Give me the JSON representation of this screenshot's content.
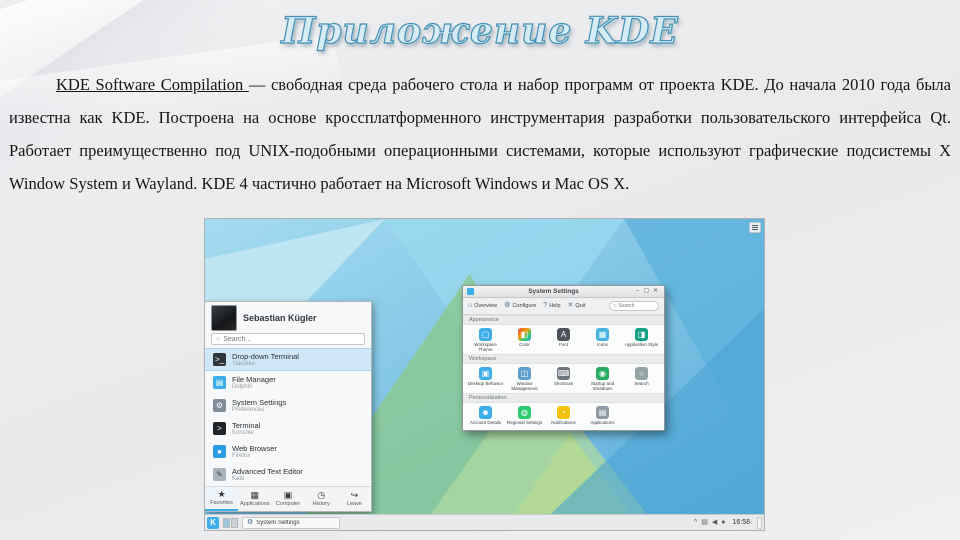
{
  "slide": {
    "title": "Приложение KDE",
    "body_lead": "KDE Software Compilation ",
    "body_rest": "— свободная среда рабочего стола и набор программ от проекта KDE. До начала 2010 года была известна как KDE. Построена на основе кроссплатформенного инструментария разработки пользовательского интерфейса Qt. Работает преимущественно под UNIX-подобными операционными системами, которые используют графические подсистемы X Window System и Wayland. KDE 4 частично работает на Microsoft Windows и Mac OS X.",
    "accent_color": "#4690b5"
  },
  "desktop": {
    "wallpaper": "kde-plasma-next-triangles",
    "launcher": {
      "user_name": "Sebastian Kügler",
      "search_placeholder": "Search...",
      "items": [
        {
          "label": "Drop-down Terminal",
          "sub": "Yakuake",
          "glyph": ">_",
          "style": "background:#31363b"
        },
        {
          "label": "File Manager",
          "sub": "Dolphin",
          "glyph": "▤",
          "style": "background:#3daee9"
        },
        {
          "label": "System Settings",
          "sub": "Preferences",
          "glyph": "⚙",
          "style": "background:#7f8c99"
        },
        {
          "label": "Terminal",
          "sub": "Konsole",
          "glyph": ">",
          "style": "background:#222629"
        },
        {
          "label": "Web Browser",
          "sub": "Firefox",
          "glyph": "●",
          "style": "background:#2d9ce2"
        },
        {
          "label": "Advanced Text Editor",
          "sub": "Kate",
          "glyph": "✎",
          "style": "background:#aab4bc;color:#41464a"
        }
      ],
      "tabs": [
        {
          "label": "Favorites",
          "glyph": "★"
        },
        {
          "label": "Applications",
          "glyph": "▦"
        },
        {
          "label": "Computer",
          "glyph": "▣"
        },
        {
          "label": "History",
          "glyph": "◷"
        },
        {
          "label": "Leave",
          "glyph": "↪"
        }
      ]
    },
    "settings": {
      "title": "System Settings",
      "window_buttons": [
        "–",
        "▢",
        "✕"
      ],
      "toolbar": [
        {
          "label": "Overview",
          "glyph": "⌂"
        },
        {
          "label": "Configure",
          "glyph": "⚙"
        },
        {
          "label": "Help",
          "glyph": "?"
        },
        {
          "label": "Quit",
          "glyph": "✕"
        }
      ],
      "search_placeholder": "Search",
      "sections": [
        {
          "title": "Appearance",
          "items": [
            {
              "label": "Workspace Theme",
              "glyph": "▢",
              "style": "background:#3daee9"
            },
            {
              "label": "Color",
              "glyph": "◧",
              "style": "background:linear-gradient(135deg,#e74c3c,#f39c12 40%,#2ecc71 70%,#3498db)"
            },
            {
              "label": "Font",
              "glyph": "A",
              "style": "background:#4d545b"
            },
            {
              "label": "Icons",
              "glyph": "▦",
              "style": "background:#48b4e0"
            },
            {
              "label": "Application Style",
              "glyph": "◨",
              "style": "background:#16a085"
            }
          ]
        },
        {
          "title": "Workspace",
          "items": [
            {
              "label": "Desktop Behavior",
              "glyph": "▣",
              "style": "background:#3daee9"
            },
            {
              "label": "Window Management",
              "glyph": "◫",
              "style": "background:#5c9fcd"
            },
            {
              "label": "Shortcuts",
              "glyph": "⌨",
              "style": "background:#6e7780"
            },
            {
              "label": "Startup and Shutdown",
              "glyph": "◉",
              "style": "background:#27ae60"
            },
            {
              "label": "Search",
              "glyph": "○",
              "style": "background:#95a5a6"
            }
          ]
        },
        {
          "title": "Personalization",
          "items": [
            {
              "label": "Account Details",
              "glyph": "☻",
              "style": "background:#3daee9"
            },
            {
              "label": "Regional Settings",
              "glyph": "◍",
              "style": "background:#2ecc71"
            },
            {
              "label": "Notifications",
              "glyph": "◔",
              "style": "background:#f1c40f"
            },
            {
              "label": "Applications",
              "glyph": "▤",
              "style": "background:#8e9aa5"
            }
          ]
        }
      ]
    },
    "taskbar": {
      "launcher_glyph": "K",
      "task": {
        "label": "System Settings",
        "glyph": "⚙"
      },
      "tray_icons": [
        "^",
        "▤",
        "◀",
        "●"
      ],
      "clock": "16:58"
    }
  }
}
